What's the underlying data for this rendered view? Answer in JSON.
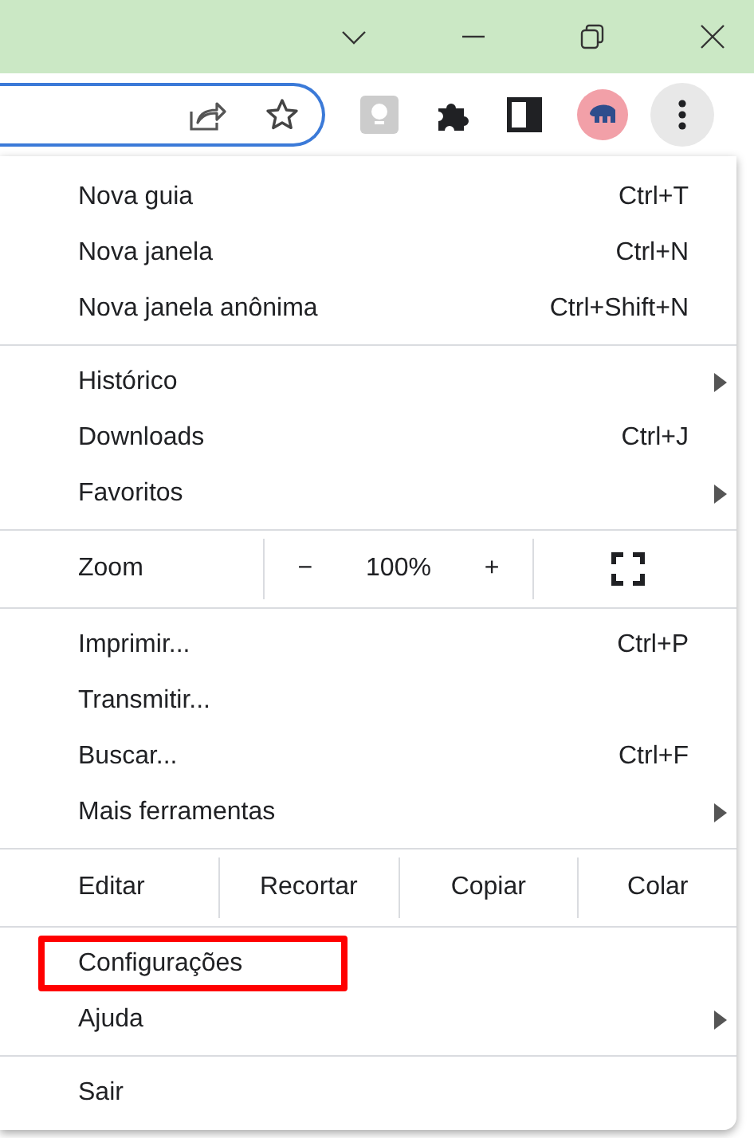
{
  "title_bar": {
    "buttons": [
      {
        "kind": "tabs"
      },
      {
        "kind": "minimize"
      },
      {
        "kind": "restore"
      },
      {
        "kind": "close"
      }
    ]
  },
  "menu": {
    "sections": [
      {
        "kind": "items",
        "items": [
          {
            "label": "Nova guia",
            "shortcut": "Ctrl+T",
            "submenu": false,
            "highlighted": false
          },
          {
            "label": "Nova janela",
            "shortcut": "Ctrl+N",
            "submenu": false,
            "highlighted": false
          },
          {
            "label": "Nova janela anônima",
            "shortcut": "Ctrl+Shift+N",
            "submenu": false,
            "highlighted": false
          }
        ]
      },
      {
        "kind": "items",
        "items": [
          {
            "label": "Histórico",
            "submenu": true,
            "highlighted": false
          },
          {
            "label": "Downloads",
            "shortcut": "Ctrl+J",
            "submenu": false,
            "highlighted": false
          },
          {
            "label": "Favoritos",
            "submenu": true,
            "highlighted": false
          }
        ]
      },
      {
        "kind": "zoom",
        "label": "Zoom",
        "minus": "−",
        "value": "100%",
        "plus": "+"
      },
      {
        "kind": "items",
        "items": [
          {
            "label": "Imprimir...",
            "shortcut": "Ctrl+P",
            "submenu": false,
            "highlighted": false
          },
          {
            "label": "Transmitir...",
            "submenu": false,
            "highlighted": false
          },
          {
            "label": "Buscar...",
            "shortcut": "Ctrl+F",
            "submenu": false,
            "highlighted": false
          },
          {
            "label": "Mais ferramentas",
            "submenu": true,
            "highlighted": false
          }
        ]
      },
      {
        "kind": "edit",
        "label": "Editar",
        "actions": [
          "Recortar",
          "Copiar",
          "Colar"
        ]
      },
      {
        "kind": "items",
        "items": [
          {
            "label": "Configurações",
            "submenu": false,
            "highlighted": true
          },
          {
            "label": "Ajuda",
            "submenu": true,
            "highlighted": false
          }
        ]
      },
      {
        "kind": "items",
        "items": [
          {
            "label": "Sair",
            "submenu": false,
            "highlighted": false
          }
        ]
      }
    ]
  }
}
